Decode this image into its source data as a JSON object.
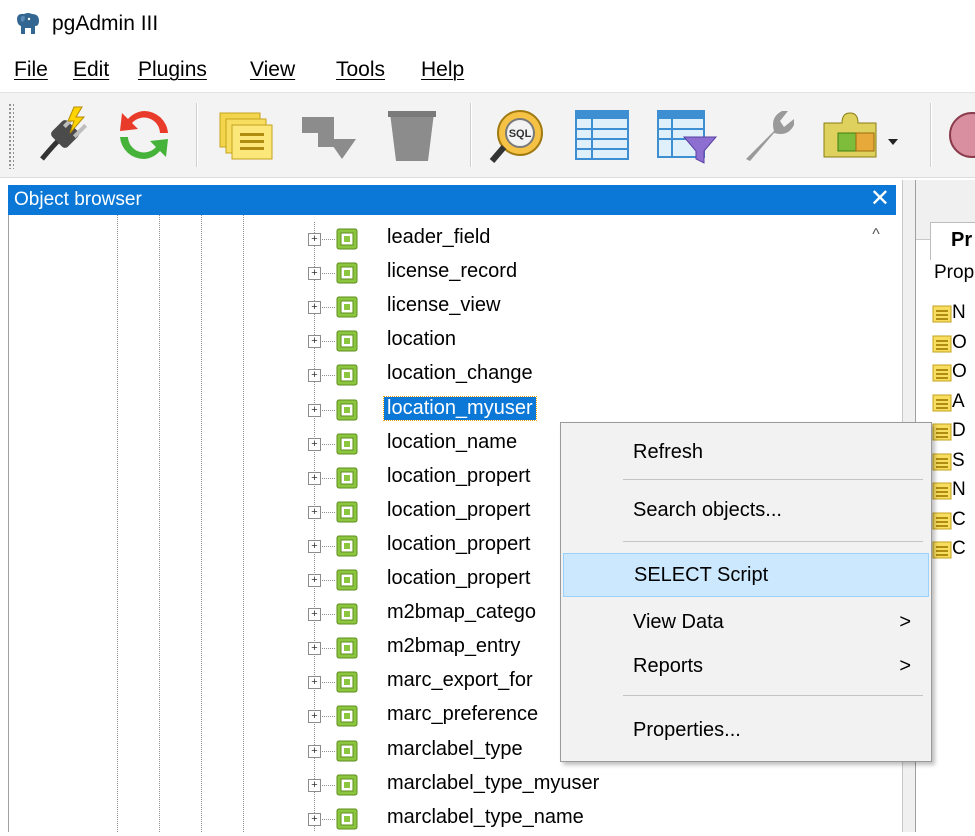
{
  "app": {
    "title": "pgAdmin III"
  },
  "menu": [
    "File",
    "Edit",
    "Plugins",
    "View",
    "Tools",
    "Help"
  ],
  "toolbar": [
    {
      "name": "connect-icon"
    },
    {
      "name": "refresh-icon"
    },
    {
      "name": "properties-icon"
    },
    {
      "name": "create-object-icon"
    },
    {
      "name": "drop-object-icon"
    },
    {
      "name": "query-tool-icon",
      "label": "SQL"
    },
    {
      "name": "view-data-icon"
    },
    {
      "name": "view-filtered-data-icon"
    },
    {
      "name": "maintenance-icon"
    },
    {
      "name": "plugins-icon"
    }
  ],
  "object_browser": {
    "title": "Object browser",
    "items": [
      "leader_field",
      "license_record",
      "license_view",
      "location",
      "location_change",
      "location_myuser",
      "location_name",
      "location_propert",
      "location_propert",
      "location_propert",
      "location_propert",
      "m2bmap_catego",
      "m2bmap_entry",
      "marc_export_for",
      "marc_preference",
      "marclabel_type",
      "marclabel_type_myuser",
      "marclabel_type_name"
    ],
    "selected_index": 5
  },
  "properties_panel": {
    "tab_label": "Pr",
    "caption": "Prop",
    "rows": [
      "N",
      "O",
      "O",
      "A",
      "D",
      "S",
      "N",
      "C",
      "C"
    ]
  },
  "context_menu": {
    "items": [
      {
        "label": "Refresh",
        "submenu": false,
        "highlighted": false
      },
      {
        "label": "Search objects...",
        "submenu": false,
        "highlighted": false
      },
      {
        "label": "SELECT Script",
        "submenu": false,
        "highlighted": true
      },
      {
        "label": "View Data",
        "submenu": true,
        "highlighted": false
      },
      {
        "label": "Reports",
        "submenu": true,
        "highlighted": false
      },
      {
        "label": "Properties...",
        "submenu": false,
        "highlighted": false
      }
    ],
    "submenu_arrow": ">"
  },
  "colors": {
    "selection": "#0b78d7",
    "menu_highlight": "#cce8ff",
    "table_icon": "#8cc63f"
  }
}
